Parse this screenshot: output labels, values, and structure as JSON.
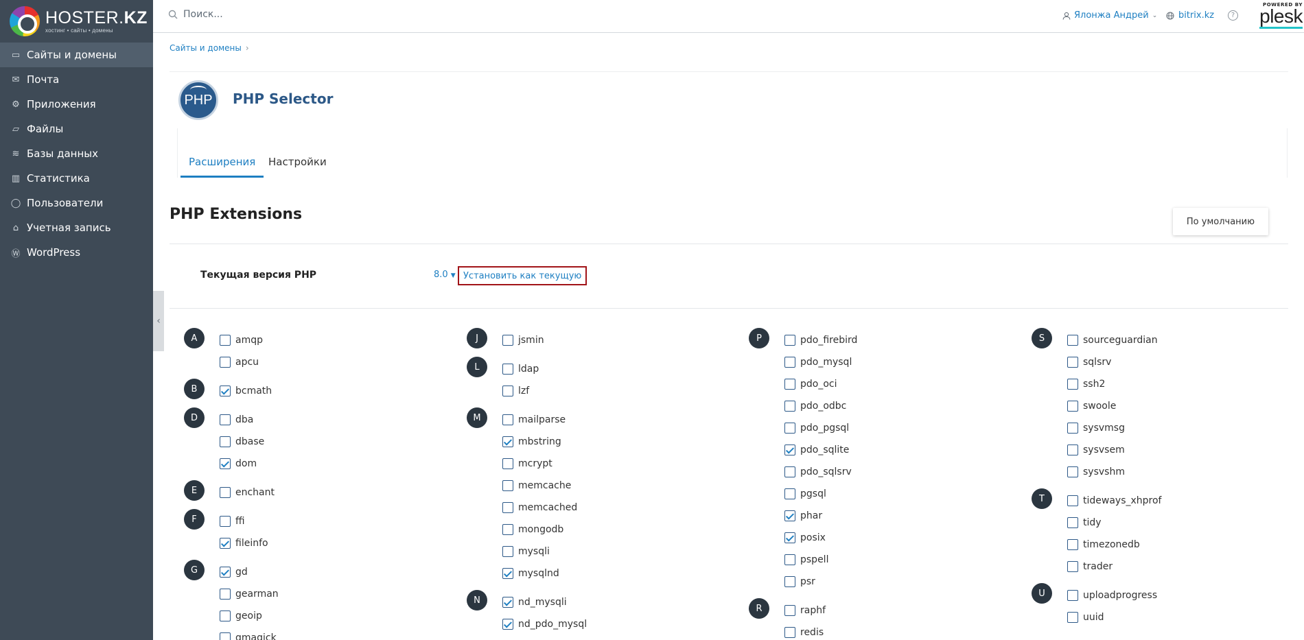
{
  "brand": {
    "name_light": "HOSTER.",
    "name_bold": "KZ",
    "tagline": "хостинг • сайты • домены"
  },
  "sidebar": {
    "items": [
      {
        "label": "Сайты и домены",
        "icon": "monitor-icon",
        "active": true
      },
      {
        "label": "Почта",
        "icon": "mail-icon"
      },
      {
        "label": "Приложения",
        "icon": "gear-icon"
      },
      {
        "label": "Файлы",
        "icon": "folder-icon"
      },
      {
        "label": "Базы данных",
        "icon": "database-icon"
      },
      {
        "label": "Статистика",
        "icon": "chart-icon"
      },
      {
        "label": "Пользователи",
        "icon": "user-icon"
      },
      {
        "label": "Учетная запись",
        "icon": "account-icon"
      },
      {
        "label": "WordPress",
        "icon": "wordpress-icon"
      }
    ]
  },
  "header": {
    "search_placeholder": "Поиск...",
    "user": "Ялонжа Андрей",
    "domain": "bitrix.kz",
    "powered_by": "POWERED BY",
    "product": "plesk"
  },
  "breadcrumb": {
    "item": "Сайты и домены"
  },
  "page": {
    "logo_text": "PHP",
    "title": "PHP Selector"
  },
  "tabs": [
    {
      "label": "Расширения",
      "active": true
    },
    {
      "label": "Настройки"
    }
  ],
  "section": {
    "title": "PHP Extensions",
    "default_button": "По умолчанию"
  },
  "version": {
    "label": "Текущая версия PHP",
    "value": "8.0",
    "set_current": "Установить как текущую"
  },
  "colors": {
    "sidebar_bg": "#3e4a56",
    "accent": "#1e7fc2",
    "highlight_border": "#a11318"
  },
  "extensions": [
    [
      {
        "letter": "A",
        "items": [
          {
            "name": "amqp",
            "checked": false
          },
          {
            "name": "apcu",
            "checked": false
          }
        ]
      },
      {
        "letter": "B",
        "items": [
          {
            "name": "bcmath",
            "checked": true
          }
        ]
      },
      {
        "letter": "D",
        "items": [
          {
            "name": "dba",
            "checked": false
          },
          {
            "name": "dbase",
            "checked": false
          },
          {
            "name": "dom",
            "checked": true
          }
        ]
      },
      {
        "letter": "E",
        "items": [
          {
            "name": "enchant",
            "checked": false
          }
        ]
      },
      {
        "letter": "F",
        "items": [
          {
            "name": "ffi",
            "checked": false
          },
          {
            "name": "fileinfo",
            "checked": true
          }
        ]
      },
      {
        "letter": "G",
        "items": [
          {
            "name": "gd",
            "checked": true
          },
          {
            "name": "gearman",
            "checked": false
          },
          {
            "name": "geoip",
            "checked": false
          },
          {
            "name": "gmagick",
            "checked": false
          }
        ]
      }
    ],
    [
      {
        "letter": "J",
        "items": [
          {
            "name": "jsmin",
            "checked": false
          }
        ]
      },
      {
        "letter": "L",
        "items": [
          {
            "name": "ldap",
            "checked": false
          },
          {
            "name": "lzf",
            "checked": false
          }
        ]
      },
      {
        "letter": "M",
        "items": [
          {
            "name": "mailparse",
            "checked": false
          },
          {
            "name": "mbstring",
            "checked": true
          },
          {
            "name": "mcrypt",
            "checked": false
          },
          {
            "name": "memcache",
            "checked": false
          },
          {
            "name": "memcached",
            "checked": false
          },
          {
            "name": "mongodb",
            "checked": false
          },
          {
            "name": "mysqli",
            "checked": false
          },
          {
            "name": "mysqlnd",
            "checked": true
          }
        ]
      },
      {
        "letter": "N",
        "items": [
          {
            "name": "nd_mysqli",
            "checked": true
          },
          {
            "name": "nd_pdo_mysql",
            "checked": true
          }
        ]
      }
    ],
    [
      {
        "letter": "P",
        "items": [
          {
            "name": "pdo_firebird",
            "checked": false
          },
          {
            "name": "pdo_mysql",
            "checked": false
          },
          {
            "name": "pdo_oci",
            "checked": false
          },
          {
            "name": "pdo_odbc",
            "checked": false
          },
          {
            "name": "pdo_pgsql",
            "checked": false
          },
          {
            "name": "pdo_sqlite",
            "checked": true
          },
          {
            "name": "pdo_sqlsrv",
            "checked": false
          },
          {
            "name": "pgsql",
            "checked": false
          },
          {
            "name": "phar",
            "checked": true
          },
          {
            "name": "posix",
            "checked": true
          },
          {
            "name": "pspell",
            "checked": false
          },
          {
            "name": "psr",
            "checked": false
          }
        ]
      },
      {
        "letter": "R",
        "items": [
          {
            "name": "raphf",
            "checked": false
          },
          {
            "name": "redis",
            "checked": false
          }
        ]
      }
    ],
    [
      {
        "letter": "S",
        "items": [
          {
            "name": "sourceguardian",
            "checked": false
          },
          {
            "name": "sqlsrv",
            "checked": false
          },
          {
            "name": "ssh2",
            "checked": false
          },
          {
            "name": "swoole",
            "checked": false
          },
          {
            "name": "sysvmsg",
            "checked": false
          },
          {
            "name": "sysvsem",
            "checked": false
          },
          {
            "name": "sysvshm",
            "checked": false
          }
        ]
      },
      {
        "letter": "T",
        "items": [
          {
            "name": "tideways_xhprof",
            "checked": false
          },
          {
            "name": "tidy",
            "checked": false
          },
          {
            "name": "timezonedb",
            "checked": false
          },
          {
            "name": "trader",
            "checked": false
          }
        ]
      },
      {
        "letter": "U",
        "items": [
          {
            "name": "uploadprogress",
            "checked": false
          },
          {
            "name": "uuid",
            "checked": false
          }
        ]
      }
    ]
  ]
}
